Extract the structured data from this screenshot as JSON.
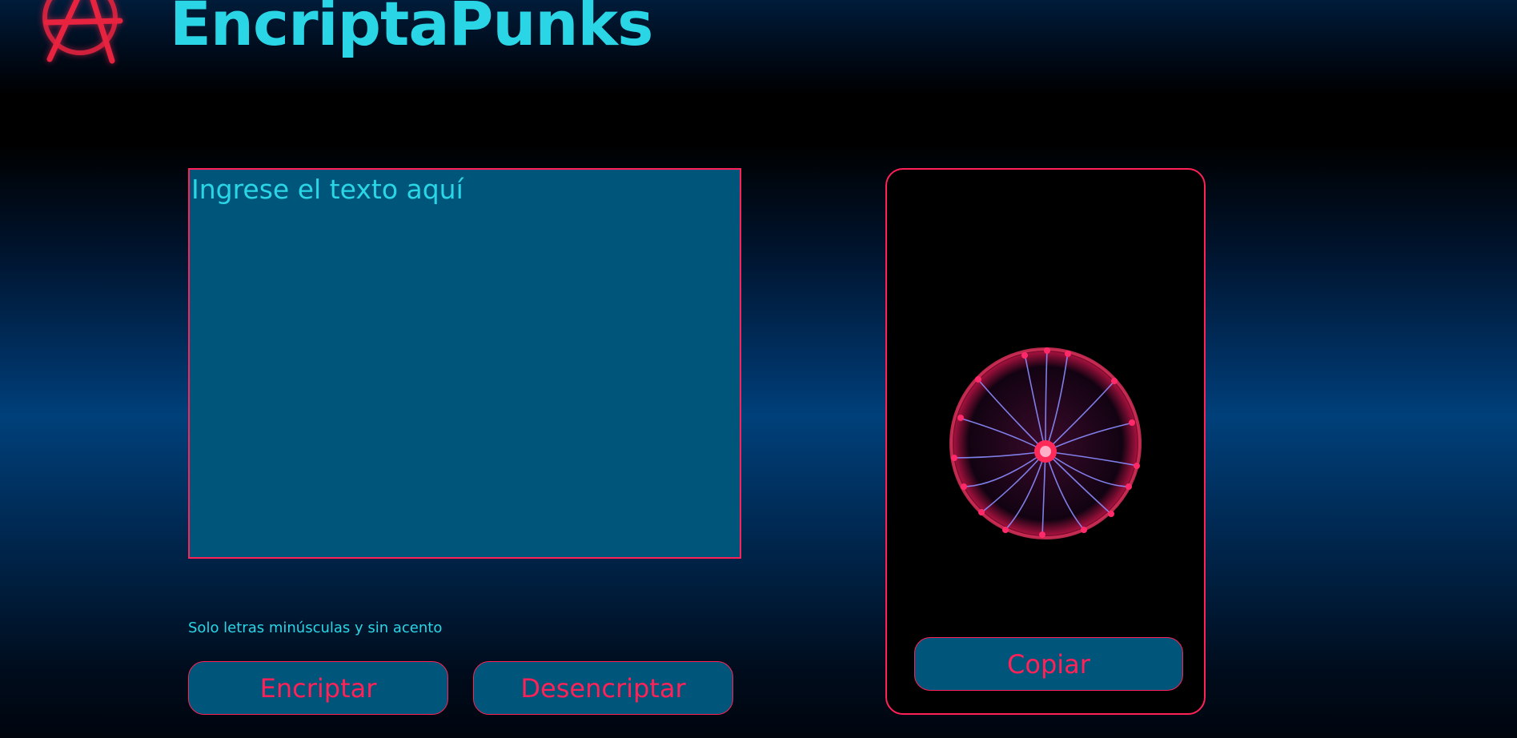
{
  "header": {
    "title": "EncriptaPunks",
    "logo_icon": "anarchy-logo-icon"
  },
  "editor": {
    "placeholder": "Ingrese el texto aquí",
    "value": ""
  },
  "hint": {
    "text": "Solo letras minúsculas y sin acento"
  },
  "actions": {
    "encrypt_label": "Encriptar",
    "decrypt_label": "Desencriptar"
  },
  "output": {
    "image_icon": "plasma-ball-icon",
    "copy_label": "Copiar"
  },
  "colors": {
    "accent": "#ff2157",
    "title": "#2ad6e6",
    "field_bg": "#00557a",
    "background": "#000000"
  }
}
